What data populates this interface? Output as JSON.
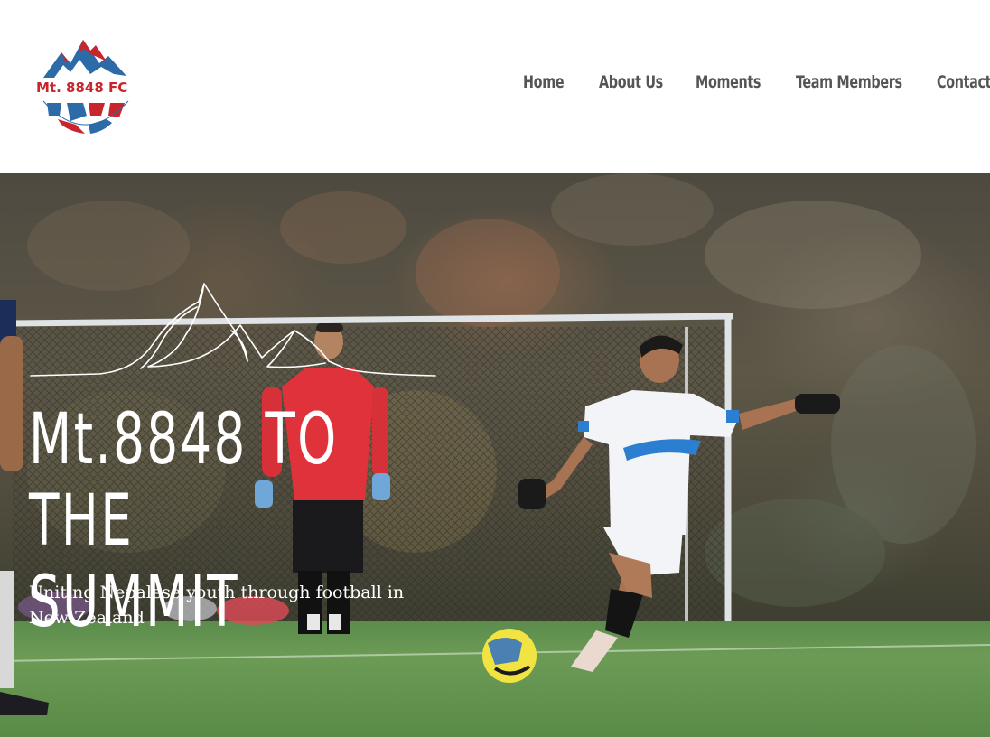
{
  "header": {
    "logo": {
      "text": "Mt. 8848 FC",
      "colors": {
        "red": "#c8262c",
        "blue": "#2d6aa8"
      }
    },
    "nav": [
      {
        "label": "Home"
      },
      {
        "label": "About Us"
      },
      {
        "label": "Moments"
      },
      {
        "label": "Team Members"
      },
      {
        "label": "Contact"
      }
    ]
  },
  "hero": {
    "title_line1": "Mt.8848 TO THE",
    "title_line2": "SUMMIT",
    "subtitle": "Uniting Nepalese youth through football in New Zealand",
    "icon": "mountain-outline-icon",
    "colors": {
      "text": "#ffffff",
      "turf": "#6c9b56",
      "keeper_shirt": "#e0323a",
      "player_shirt": "#f2f4f7"
    }
  }
}
